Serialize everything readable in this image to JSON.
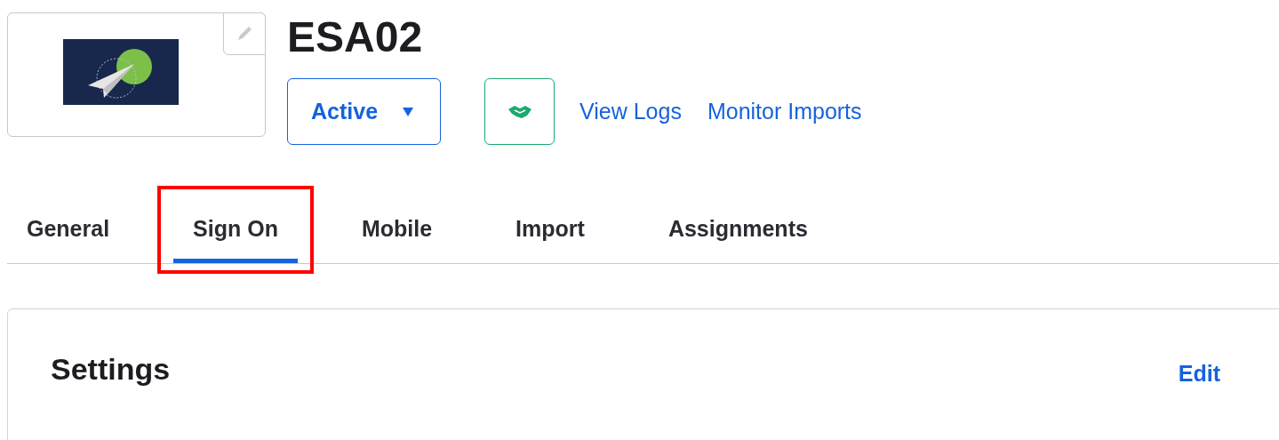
{
  "app": {
    "name": "ESA02",
    "status": "Active",
    "links": [
      "View Logs",
      "Monitor Imports"
    ]
  },
  "tabs": [
    {
      "label": "General",
      "selected": false,
      "highlighted": false
    },
    {
      "label": "Sign On",
      "selected": true,
      "highlighted": true
    },
    {
      "label": "Mobile",
      "selected": false,
      "highlighted": false
    },
    {
      "label": "Import",
      "selected": false,
      "highlighted": false
    },
    {
      "label": "Assignments",
      "selected": false,
      "highlighted": false
    }
  ],
  "settings": {
    "title": "Settings",
    "action": "Edit"
  }
}
